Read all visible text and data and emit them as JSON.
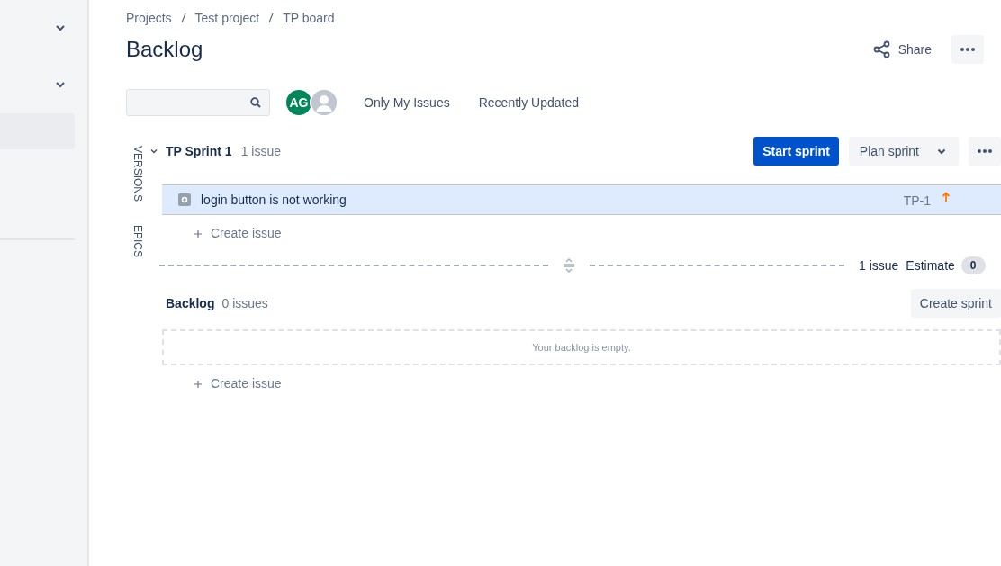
{
  "breadcrumbs": [
    "Projects",
    "Test project",
    "TP board"
  ],
  "title": "Backlog",
  "header_actions": {
    "share": "Share"
  },
  "filters": {
    "avatars": [
      {
        "kind": "initials",
        "text": "AG"
      },
      {
        "kind": "anonymous"
      }
    ],
    "quick_filters": [
      "Only My Issues",
      "Recently Updated"
    ]
  },
  "side_tabs": [
    "VERSIONS",
    "EPICS"
  ],
  "sprint": {
    "name": "TP Sprint 1",
    "count": "1 issue",
    "expanded": true,
    "start_button": "Start sprint",
    "plan_button": "Plan sprint",
    "issues": [
      {
        "summary": "login button is not working",
        "key": "TP-1",
        "selected": true
      }
    ],
    "create_issue": "Create issue",
    "footer": {
      "count": "1 issue",
      "estimate_label": "Estimate",
      "estimate": "0"
    }
  },
  "backlog": {
    "name": "Backlog",
    "count": "0 issues",
    "create_sprint": "Create sprint",
    "empty_message": "Your backlog is empty.",
    "create_issue": "Create issue"
  }
}
